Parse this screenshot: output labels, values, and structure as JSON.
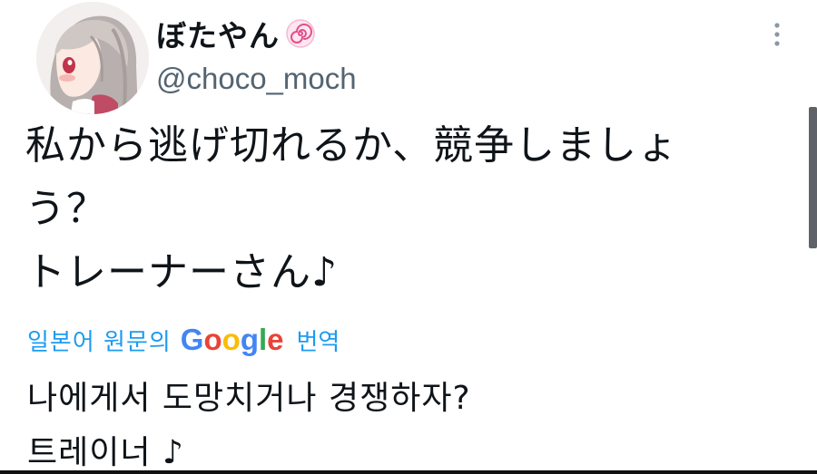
{
  "author": {
    "display_name": "ぼたやん",
    "name_emoji": "spiral-emoji",
    "handle": "@choco_moch"
  },
  "tweet": {
    "lines": [
      "私から逃げ切れるか、競争しましょ",
      "う？",
      "トレーナーさん♪"
    ]
  },
  "translation": {
    "prefix": "일본어 원문의",
    "google_letters": [
      "G",
      "o",
      "o",
      "g",
      "l",
      "e"
    ],
    "suffix": "번역",
    "lines": [
      "나에게서 도망치거나 경쟁하자?",
      "트레이너 ♪"
    ]
  },
  "colors": {
    "text": "#0f1419",
    "secondary": "#536471",
    "link": "#1d9bf0",
    "google_blue": "#4285f4",
    "google_red": "#ea4335",
    "google_yellow": "#fbbc05",
    "google_green": "#34a853"
  },
  "icons": {
    "more": "more-vertical-icon"
  }
}
